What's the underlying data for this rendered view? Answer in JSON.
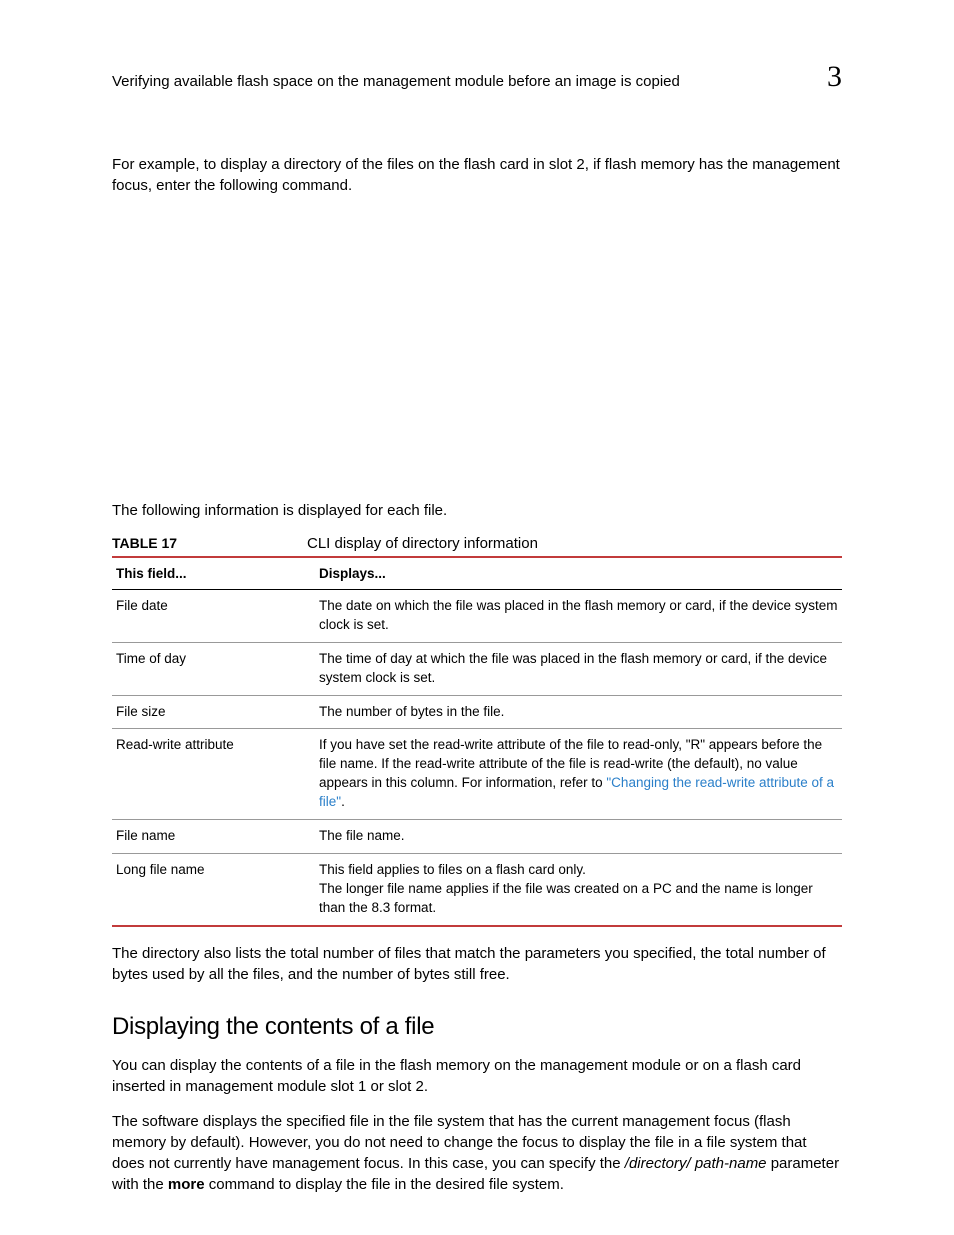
{
  "header": {
    "title": "Verifying available flash space on the management  module before an image is copied",
    "chapter": "3"
  },
  "intro": "For example, to display a directory of the files on the flash card in slot 2, if flash memory has the management focus, enter the following command.",
  "lead_in": "The following information is displayed for each file.",
  "table": {
    "label": "TABLE 17",
    "title": "CLI display of directory information",
    "head_field": "This field...",
    "head_displays": "Displays...",
    "rows": [
      {
        "field": "File date",
        "displays": "The date on which the file was placed in the flash memory or card, if the device system clock is set."
      },
      {
        "field": "Time of day",
        "displays": "The time of day at which the file was placed in the flash memory or card, if the device system clock is set."
      },
      {
        "field": "File size",
        "displays": "The number of bytes in the file."
      },
      {
        "field": "Read-write attribute",
        "displays_pre": "If you have set the read-write attribute of the file to read-only, \"R\" appears before the file name. If the read-write attribute of the file is read-write (the default), no value appears in this column. For information, refer to ",
        "displays_link": "\"Changing the read-write attribute of a file\"",
        "displays_post": "."
      },
      {
        "field": "File name",
        "displays": "The file name."
      },
      {
        "field": "Long file name",
        "displays_line1": "This field applies to files on a flash card only.",
        "displays_line2": "The longer file name applies if the file was created on a PC and the name is longer than the 8.3 format."
      }
    ]
  },
  "after_table": "The directory also lists the total number of files that match the parameters you specified, the total number of bytes used by all the files, and the number of bytes still free.",
  "section": {
    "heading": "Displaying the contents of a file",
    "para1": "You can display the contents of a file in the flash memory on the management module or on a flash card inserted in management module slot 1 or slot 2.",
    "para2_a": "The software displays the specified file in the file system that has the current management focus (flash memory by default). However, you do not need to change the focus to display the file in a file system that does not currently have management focus. In this case, you can specify the ",
    "para2_param": "/directory/ path-name",
    "para2_b": " parameter with the ",
    "para2_cmd": "more",
    "para2_c": " command to display the file in the desired file system."
  }
}
